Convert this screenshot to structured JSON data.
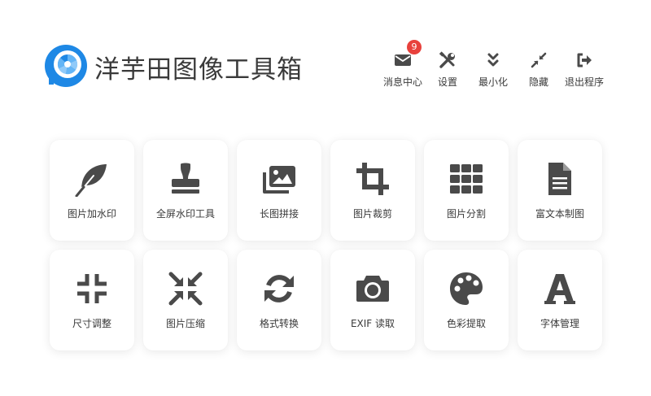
{
  "app": {
    "title": "洋芋田图像工具箱",
    "accent": "#1e88e5"
  },
  "header_actions": [
    {
      "label": "消息中心",
      "icon": "envelope-icon",
      "badge": "9"
    },
    {
      "label": "设置",
      "icon": "tools-icon"
    },
    {
      "label": "最小化",
      "icon": "double-chevron-down-icon"
    },
    {
      "label": "隐藏",
      "icon": "compress-arrows-icon"
    },
    {
      "label": "退出程序",
      "icon": "sign-out-icon"
    }
  ],
  "tools": [
    {
      "label": "图片加水印",
      "icon": "feather-icon"
    },
    {
      "label": "全屏水印工具",
      "icon": "stamp-icon"
    },
    {
      "label": "长图拼接",
      "icon": "images-icon"
    },
    {
      "label": "图片裁剪",
      "icon": "crop-icon"
    },
    {
      "label": "图片分割",
      "icon": "grid-icon"
    },
    {
      "label": "富文本制图",
      "icon": "file-text-icon"
    },
    {
      "label": "尺寸调整",
      "icon": "compress-icon"
    },
    {
      "label": "图片压缩",
      "icon": "compress-arrows-alt-icon"
    },
    {
      "label": "格式转换",
      "icon": "sync-icon"
    },
    {
      "label": "EXIF 读取",
      "icon": "camera-icon"
    },
    {
      "label": "色彩提取",
      "icon": "palette-icon"
    },
    {
      "label": "字体管理",
      "icon": "font-icon"
    }
  ],
  "colors": {
    "icon": "#4a4a4a",
    "badge": "#e8413c"
  }
}
